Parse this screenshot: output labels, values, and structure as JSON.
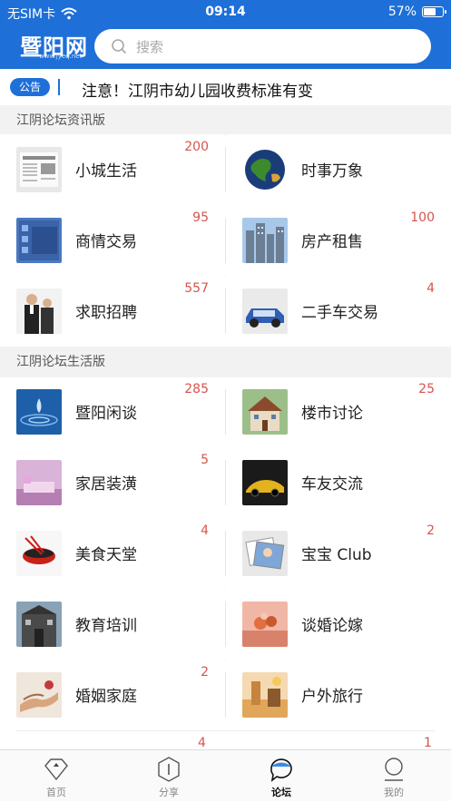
{
  "status_bar": {
    "carrier": "无SIM卡",
    "time": "09:14",
    "battery": "57%"
  },
  "header": {
    "logo": "暨阳网",
    "logo_sub": "www.jyeq.net",
    "search_placeholder": "搜索"
  },
  "notice": {
    "tag": "公告",
    "text": "注意！江阴市幼儿园收费标准有变"
  },
  "sections": [
    {
      "title": "江阴论坛资讯版",
      "items": [
        {
          "label": "小城生活",
          "count": "200",
          "thumb": "newspaper"
        },
        {
          "label": "时事万象",
          "count": "",
          "thumb": "globe"
        },
        {
          "label": "商情交易",
          "count": "95",
          "thumb": "screen"
        },
        {
          "label": "房产租售",
          "count": "100",
          "thumb": "buildings"
        },
        {
          "label": "求职招聘",
          "count": "557",
          "thumb": "people"
        },
        {
          "label": "二手车交易",
          "count": "4",
          "thumb": "car"
        }
      ]
    },
    {
      "title": "江阴论坛生活版",
      "items": [
        {
          "label": "暨阳闲谈",
          "count": "285",
          "thumb": "water-drop"
        },
        {
          "label": "楼市讨论",
          "count": "25",
          "thumb": "house"
        },
        {
          "label": "家居装潢",
          "count": "5",
          "thumb": "bedroom"
        },
        {
          "label": "车友交流",
          "count": "",
          "thumb": "sportscar"
        },
        {
          "label": "美食天堂",
          "count": "4",
          "thumb": "bowl"
        },
        {
          "label": "宝宝 Club",
          "count": "2",
          "thumb": "photo"
        },
        {
          "label": "教育培训",
          "count": "",
          "thumb": "school"
        },
        {
          "label": "谈婚论嫁",
          "count": "",
          "thumb": "wedding"
        },
        {
          "label": "婚姻家庭",
          "count": "2",
          "thumb": "hands"
        },
        {
          "label": "户外旅行",
          "count": "",
          "thumb": "travel"
        }
      ]
    }
  ],
  "peek_counts": [
    "4",
    "1"
  ],
  "tabs": [
    {
      "label": "首页",
      "icon": "home-diamond-icon",
      "active": false
    },
    {
      "label": "分享",
      "icon": "share-badge-icon",
      "active": false
    },
    {
      "label": "论坛",
      "icon": "forum-bubble-icon",
      "active": true
    },
    {
      "label": "我的",
      "icon": "profile-icon",
      "active": false
    }
  ],
  "colors": {
    "brand": "#1e6fd8",
    "count": "#d9534f",
    "section_bg": "#f2f2f2"
  }
}
